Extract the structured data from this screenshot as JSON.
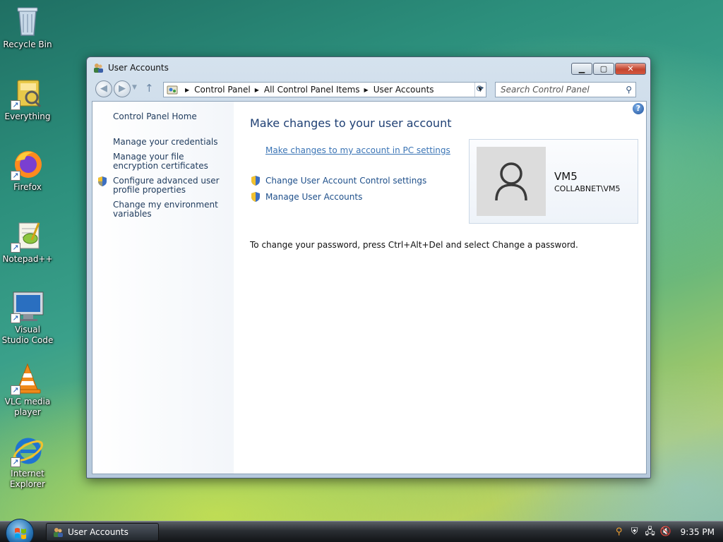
{
  "desktop": {
    "icons": [
      {
        "label": "Recycle Bin",
        "shortcut": false
      },
      {
        "label": "Everything",
        "shortcut": true
      },
      {
        "label": "Firefox",
        "shortcut": true
      },
      {
        "label": "Notepad++",
        "shortcut": true
      },
      {
        "label": "Visual Studio Code",
        "shortcut": true
      },
      {
        "label": "VLC media player",
        "shortcut": true
      },
      {
        "label": "Internet Explorer",
        "shortcut": true
      }
    ]
  },
  "window": {
    "title": "User Accounts",
    "minimize_glyph": "▁",
    "maximize_glyph": "▢",
    "close_glyph": "✕"
  },
  "navbar": {
    "breadcrumb": [
      "Control Panel",
      "All Control Panel Items",
      "User Accounts"
    ],
    "search_placeholder": "Search Control Panel"
  },
  "left_pane": {
    "home": "Control Panel Home",
    "links": [
      "Manage your credentials",
      "Manage your file encryption certificates",
      "Configure advanced user profile properties",
      "Change my environment variables"
    ]
  },
  "main": {
    "heading": "Make changes to your user account",
    "pc_settings_link": "Make changes to my account in PC settings",
    "uac_link": "Change User Account Control settings",
    "manage_link": "Manage User Accounts",
    "password_note": "To change your password, press Ctrl+Alt+Del and select Change a password."
  },
  "user_card": {
    "name": "VM5",
    "domain_user": "COLLABNET\\VM5"
  },
  "taskbar": {
    "task_label": "User Accounts",
    "clock": "9:35 PM"
  },
  "colors": {
    "link": "#1e4f8a",
    "heading": "#1e3f73",
    "left_link": "#1e3a5c"
  }
}
